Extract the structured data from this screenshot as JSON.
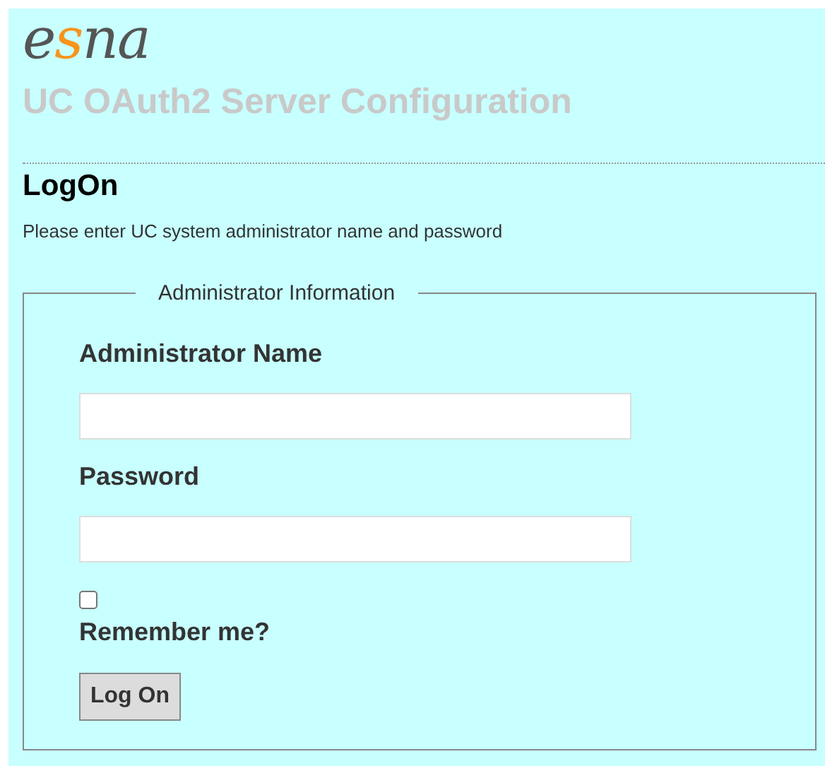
{
  "logo": "esna",
  "title": "UC OAuth2 Server Configuration",
  "heading": "LogOn",
  "description": "Please enter UC system administrator name and password",
  "fieldset": {
    "legend": "Administrator Information",
    "fields": [
      {
        "label": "Administrator Name"
      },
      {
        "label": "Password"
      }
    ],
    "remember": {
      "label": "Remember me?",
      "checked": false
    },
    "button": "Log On"
  }
}
